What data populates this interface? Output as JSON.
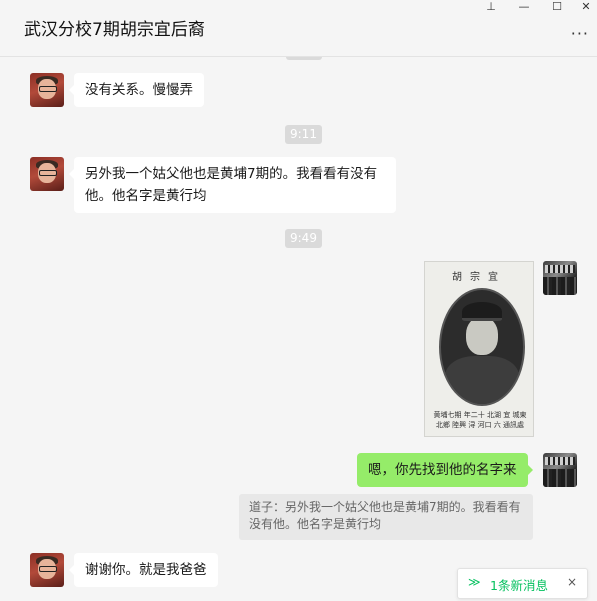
{
  "window": {
    "title": "武汉分校7期胡宗宜后裔",
    "pin": "⊥",
    "minimize": "—",
    "maximize": "☐",
    "close": "✕",
    "more": "···"
  },
  "messages": [
    {
      "text": "没有关系。慢慢弄"
    },
    {
      "time": "9:11"
    },
    {
      "text": "另外我一个姑父他也是黄埔7期的。我看看有没有他。他名字是黄行均"
    },
    {
      "time": "9:49"
    },
    {
      "text": "嗯，你先找到他的名字来"
    },
    {
      "text": "谢谢你。就是我爸爸"
    }
  ],
  "photo": {
    "caption_top": "胡宗宜",
    "caption_bottom": "黄埔七期 年二十 北湖 宜 城東北鄉 陸興 浔 河口 六  通訊處"
  },
  "quote": {
    "text": "道子：另外我一个姑父他也是黄埔7期的。我看看有没有他。他名字是黄行均"
  },
  "new_message": {
    "icon": "≫",
    "label": "1条新消息",
    "close": "×"
  },
  "colors": {
    "background": "#f5f5f5",
    "outgoing_bubble": "#95ec69",
    "incoming_bubble": "#ffffff",
    "accent": "#07c160"
  }
}
